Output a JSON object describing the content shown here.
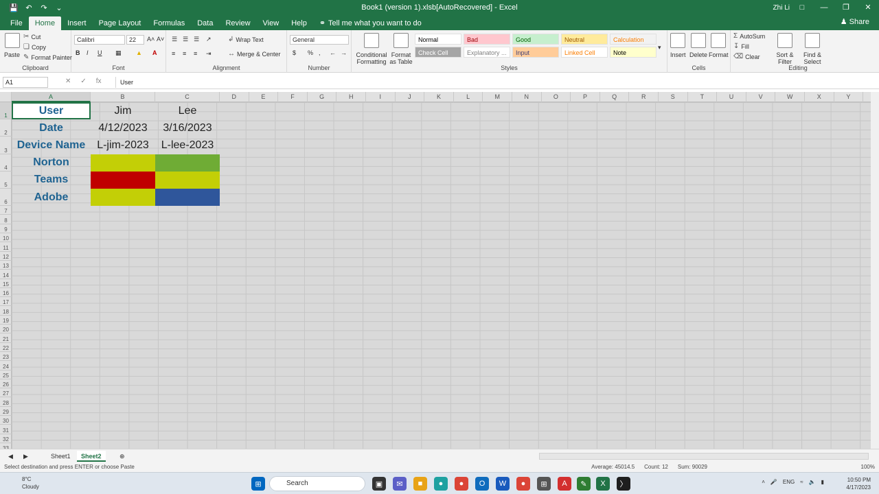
{
  "window": {
    "title": "Book1 (version 1).xlsb[AutoRecovered] - Excel",
    "user": "Zhi Li"
  },
  "menu": {
    "tabs": [
      "File",
      "Home",
      "Insert",
      "Page Layout",
      "Formulas",
      "Data",
      "Review",
      "View",
      "Help"
    ],
    "active_tab": "Home",
    "tell_me": "Tell me what you want to do",
    "share": "Share"
  },
  "ribbon": {
    "clipboard": {
      "label": "Clipboard",
      "paste": "Paste",
      "cut": "Cut",
      "copy": "Copy",
      "format_painter": "Format Painter"
    },
    "font": {
      "label": "Font",
      "name": "Calibri",
      "size": "22"
    },
    "alignment": {
      "label": "Alignment",
      "wrap": "Wrap Text",
      "merge": "Merge & Center"
    },
    "number": {
      "label": "Number",
      "format": "General"
    },
    "styles": {
      "label": "Styles",
      "conditional": "Conditional Formatting",
      "format_table": "Format as Table",
      "items": [
        {
          "name": "Normal",
          "bg": "#ffffff",
          "fg": "#000000"
        },
        {
          "name": "Bad",
          "bg": "#ffc7ce",
          "fg": "#9c0006"
        },
        {
          "name": "Good",
          "bg": "#c6efce",
          "fg": "#006100"
        },
        {
          "name": "Neutral",
          "bg": "#ffeb9c",
          "fg": "#9c5700"
        },
        {
          "name": "Calculation",
          "bg": "#f2f2f2",
          "fg": "#fa7d00"
        },
        {
          "name": "Check Cell",
          "bg": "#a5a5a5",
          "fg": "#ffffff"
        },
        {
          "name": "Explanatory ...",
          "bg": "#ffffff",
          "fg": "#7f7f7f"
        },
        {
          "name": "Input",
          "bg": "#ffcc99",
          "fg": "#3f3f76"
        },
        {
          "name": "Linked Cell",
          "bg": "#ffffff",
          "fg": "#fa7d00"
        },
        {
          "name": "Note",
          "bg": "#ffffcc",
          "fg": "#000000"
        }
      ]
    },
    "cells": {
      "label": "Cells",
      "insert": "Insert",
      "delete": "Delete",
      "format": "Format"
    },
    "editing": {
      "label": "Editing",
      "autosum": "AutoSum",
      "fill": "Fill",
      "clear": "Clear",
      "sort": "Sort & Filter",
      "find": "Find & Select"
    }
  },
  "formula_bar": {
    "name_box": "A1",
    "content": "User",
    "fx": "fx"
  },
  "grid": {
    "columns": [
      "A",
      "B",
      "C",
      "D",
      "E",
      "F",
      "G",
      "H",
      "I",
      "J",
      "K",
      "L",
      "M",
      "N",
      "O",
      "P",
      "Q",
      "R",
      "S",
      "T",
      "U",
      "V",
      "W",
      "X",
      "Y"
    ],
    "rows": [
      "1",
      "2",
      "3",
      "4",
      "5",
      "6",
      "7",
      "8",
      "9",
      "10",
      "11",
      "12",
      "13",
      "14",
      "15",
      "16",
      "17",
      "18",
      "19",
      "20",
      "21",
      "22",
      "23",
      "24",
      "25",
      "26",
      "27",
      "28",
      "29",
      "30",
      "31",
      "32",
      "33"
    ],
    "table": {
      "labels": [
        "User",
        "Date",
        "Device Name",
        "Norton",
        "Teams",
        "Adobe"
      ],
      "col_b": [
        "Jim",
        "4/12/2023",
        "L-jim-2023",
        "",
        "",
        ""
      ],
      "col_c": [
        "Lee",
        "3/16/2023",
        "L-lee-2023",
        "",
        "",
        ""
      ],
      "fill_b": [
        "",
        "",
        "",
        "#c3cf06",
        "#c00000",
        "#c3cf06"
      ],
      "fill_c": [
        "",
        "",
        "",
        "#6fac35",
        "#c3cf06",
        "#2f569b"
      ]
    },
    "label_color": "#1f6391"
  },
  "sheets": {
    "tabs": [
      "Sheet1",
      "Sheet2"
    ],
    "active": "Sheet2"
  },
  "status": {
    "message": "Select destination and press ENTER or choose Paste",
    "average": "Average: 45014.5",
    "count": "Count: 12",
    "sum": "Sum: 90029",
    "zoom": "100%"
  },
  "taskbar": {
    "weather_temp": "8°C",
    "weather_desc": "Cloudy",
    "search": "Search",
    "lang": "ENG",
    "time": "10:50 PM",
    "date": "4/17/2023"
  },
  "accent": "#217346"
}
